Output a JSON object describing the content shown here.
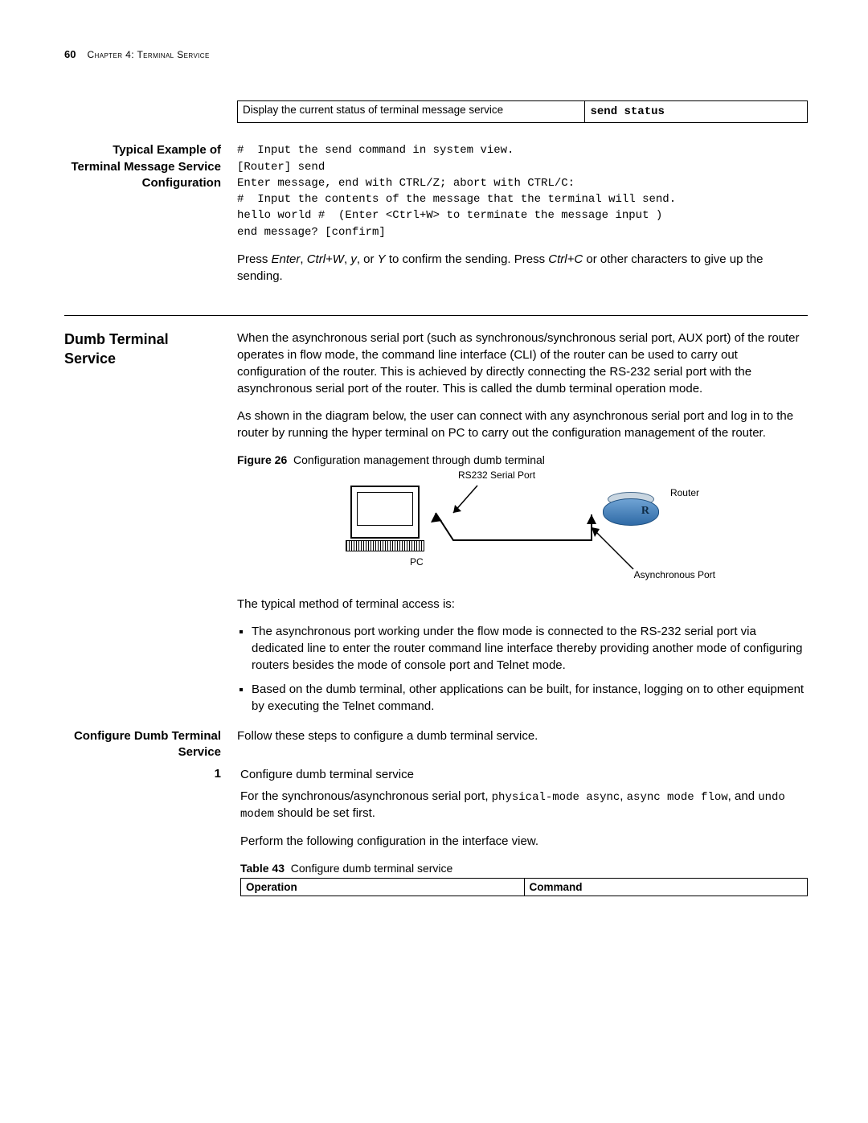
{
  "header": {
    "page_number": "60",
    "chapter": "Chapter 4: Terminal Service"
  },
  "table42": {
    "row_desc": "Display the current status of terminal message service",
    "row_cmd": "send status"
  },
  "section_typical": {
    "heading": "Typical Example of Terminal Message Service Configuration",
    "code": "#  Input the send command in system view.\n[Router] send\nEnter message, end with CTRL/Z; abort with CTRL/C:\n#  Input the contents of the message that the terminal will send.\nhello world #  (Enter <Ctrl+W> to terminate the message input )\nend message? [confirm]",
    "after": "Press Enter, Ctrl+W, y, or Y to confirm the sending. Press Ctrl+C or other characters to give up the sending."
  },
  "section_dumb": {
    "heading": "Dumb Terminal Service",
    "p1": "When the asynchronous serial port (such as synchronous/synchronous serial port, AUX port) of the router operates in flow mode, the command line interface (CLI) of the router can be used to carry out configuration of the router. This is achieved by directly connecting the RS-232 serial port with the asynchronous serial port of the router. This is called the dumb terminal operation mode.",
    "p2": "As shown in the diagram below, the user can connect with any asynchronous serial port and log in to the router by running the hyper terminal on PC to carry out the configuration management of the router.",
    "fig_label": "Figure 26",
    "fig_caption": "Configuration management through dumb terminal",
    "fig_labels": {
      "rs232": "RS232 Serial Port",
      "router": "Router",
      "pc": "PC",
      "async": "Asynchronous Port"
    },
    "p3": "The typical method of terminal access is:",
    "bullets": [
      "The asynchronous port working under the flow mode is connected to the RS-232 serial port via dedicated line to enter the router command line interface thereby providing another mode of configuring routers besides the mode of console port and Telnet mode.",
      "Based on the dumb terminal, other applications can be built, for instance, logging on to other equipment by executing the Telnet command."
    ]
  },
  "section_conf": {
    "heading": "Configure Dumb Terminal Service",
    "intro": "Follow these steps to configure a dumb terminal service.",
    "step1_title": "Configure dumb terminal service",
    "step1_p1a": "For the synchronous/asynchronous serial port, ",
    "step1_code1": "physical-mode async",
    "step1_comma": ", ",
    "step1_code2": "async mode flow",
    "step1_mid": ", and ",
    "step1_code3": "undo modem",
    "step1_p1b": " should be set first.",
    "step1_p2": "Perform the following configuration in the interface view.",
    "tbl_label": "Table 43",
    "tbl_caption": "Configure dumb terminal service",
    "tbl_h1": "Operation",
    "tbl_h2": "Command",
    "num1": "1"
  }
}
